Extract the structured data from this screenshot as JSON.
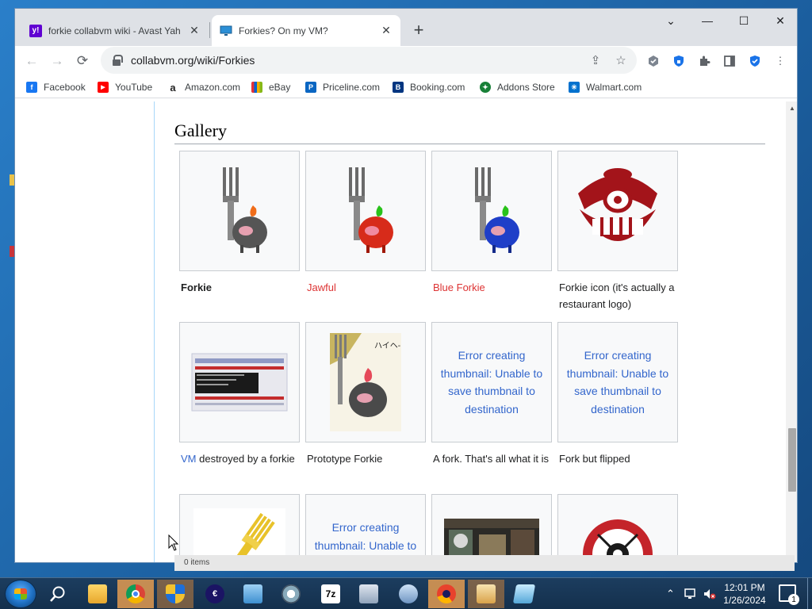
{
  "browser": {
    "tabs": [
      {
        "title": "forkie collabvm wiki - Avast Yah",
        "favicon": "yahoo-favicon",
        "active": false
      },
      {
        "title": "Forkies? On my VM?",
        "favicon": "monitor-favicon",
        "active": true
      }
    ],
    "new_tab_label": "+",
    "window_controls": {
      "chevron": "⌄",
      "minimize": "—",
      "maximize": "☐",
      "close": "✕"
    },
    "nav": {
      "back": "←",
      "forward": "→",
      "reload": "⟳"
    },
    "address": "collabvm.org/wiki/Forkies",
    "bookmarks": [
      {
        "label": "Facebook",
        "icon": "facebook-icon",
        "color": "#1877f2",
        "glyph": "f"
      },
      {
        "label": "YouTube",
        "icon": "youtube-icon",
        "color": "#ff0000",
        "glyph": "▶"
      },
      {
        "label": "Amazon.com",
        "icon": "amazon-icon",
        "color": "#222222",
        "glyph": "a"
      },
      {
        "label": "eBay",
        "icon": "ebay-icon",
        "color": "#e53238",
        "glyph": "e"
      },
      {
        "label": "Priceline.com",
        "icon": "priceline-icon",
        "color": "#0a66c2",
        "glyph": "P"
      },
      {
        "label": "Booking.com",
        "icon": "booking-icon",
        "color": "#003580",
        "glyph": "B"
      },
      {
        "label": "Addons Store",
        "icon": "addons-store-icon",
        "color": "#188038",
        "glyph": "✦"
      },
      {
        "label": "Walmart.com",
        "icon": "walmart-icon",
        "color": "#0071ce",
        "glyph": "✳"
      }
    ]
  },
  "page": {
    "section_heading": "Gallery",
    "gallery": [
      {
        "caption": "Forkie",
        "style": "bold",
        "image": "forkie-gray"
      },
      {
        "caption": "Jawful",
        "style": "red",
        "image": "forkie-red"
      },
      {
        "caption": "Blue Forkie",
        "style": "red",
        "image": "forkie-blue"
      },
      {
        "caption": "Forkie icon (it's actually a restaurant logo)",
        "style": "normal",
        "image": "restaurant-logo"
      },
      {
        "caption_link": "VM",
        "caption": " destroyed by a forkie",
        "style": "normal",
        "image": "vm-windows"
      },
      {
        "caption": "Prototype Forkie",
        "style": "normal",
        "image": "prototype-forkie",
        "image_text": "ハイヘ-"
      },
      {
        "caption": "A fork. That's all what it is",
        "style": "normal",
        "error": "Error creating thumbnail: Unable to save thumbnail to destination"
      },
      {
        "caption": "Fork but flipped",
        "style": "normal",
        "error": "Error creating thumbnail: Unable to save thumbnail to destination"
      },
      {
        "caption": "",
        "style": "normal",
        "image": "gold-fork"
      },
      {
        "caption": "",
        "style": "normal",
        "error": "Error creating thumbnail: Unable to save thumbnail to destination"
      },
      {
        "caption": "",
        "style": "normal",
        "image": "restaurant-interior"
      },
      {
        "caption": "",
        "style": "normal",
        "image": "restaurant-sign"
      }
    ],
    "status_peek": "0 items"
  },
  "taskbar": {
    "clock_time": "12:01 PM",
    "clock_date": "1/26/2024",
    "notification_count": "1",
    "apps": [
      {
        "name": "search",
        "icon": "search-icon"
      },
      {
        "name": "file-explorer",
        "icon": "folder-icon"
      },
      {
        "name": "chrome",
        "icon": "chrome-icon"
      },
      {
        "name": "security-shield",
        "icon": "shield-icon"
      },
      {
        "name": "app-e",
        "icon": "e-app-icon"
      },
      {
        "name": "control-panel",
        "icon": "control-panel-icon"
      },
      {
        "name": "media-tool",
        "icon": "media-icon"
      },
      {
        "name": "7zip",
        "icon": "7zip-icon",
        "glyph": "7z"
      },
      {
        "name": "archive-tool",
        "icon": "archive-icon"
      },
      {
        "name": "utility",
        "icon": "utility-icon"
      },
      {
        "name": "firefox-like",
        "icon": "browser-icon"
      },
      {
        "name": "mail",
        "icon": "mail-icon"
      },
      {
        "name": "notepad",
        "icon": "notepad-icon"
      }
    ]
  }
}
